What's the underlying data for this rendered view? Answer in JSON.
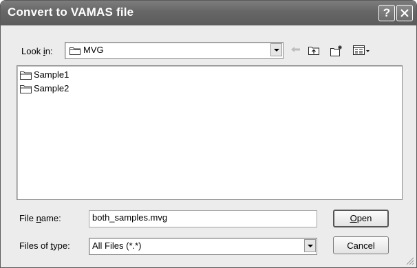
{
  "window": {
    "title": "Convert to VAMAS file",
    "help_glyph": "?",
    "close_glyph": "X"
  },
  "lookin": {
    "label_pre": "Look ",
    "label_accel": "i",
    "label_post": "n:",
    "value": "MVG"
  },
  "toolbar": {
    "icons": [
      "back-arrow-icon",
      "up-folder-icon",
      "new-folder-icon",
      "view-menu-icon"
    ]
  },
  "files": [
    {
      "name": "Sample1",
      "icon": "folder-icon"
    },
    {
      "name": "Sample2",
      "icon": "folder-icon"
    }
  ],
  "filename": {
    "label_pre": "File ",
    "label_accel": "n",
    "label_post": "ame:",
    "value": "both_samples.mvg"
  },
  "filetype": {
    "label_pre": "Files of ",
    "label_accel": "t",
    "label_post": "ype:",
    "value": "All Files (*.*)"
  },
  "buttons": {
    "open_accel": "O",
    "open_rest": "pen",
    "cancel": "Cancel"
  },
  "colors": {
    "titlebar": "#666666",
    "dialog_bg": "#ececec"
  }
}
